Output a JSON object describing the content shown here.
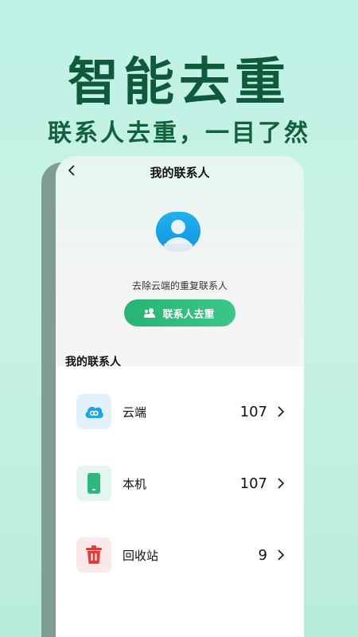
{
  "hero": {
    "title": "智能去重",
    "subtitle": "联系人去重，一目了然"
  },
  "screen": {
    "back_icon": "chevron-left-icon",
    "title": "我的联系人",
    "description": "去除云端的重复联系人",
    "dedupe_button_label": "联系人去重",
    "section_title": "我的联系人",
    "rows": [
      {
        "label": "云端",
        "count": "107",
        "icon": "cloud-icon"
      },
      {
        "label": "本机",
        "count": "107",
        "icon": "phone-icon"
      },
      {
        "label": "回收站",
        "count": "9",
        "icon": "trash-icon"
      }
    ]
  },
  "colors": {
    "hero_text": "#0f5a3b",
    "accent_green": "#2db97b",
    "cloud_blue": "#1aa5e8",
    "trash_red": "#e53935"
  }
}
